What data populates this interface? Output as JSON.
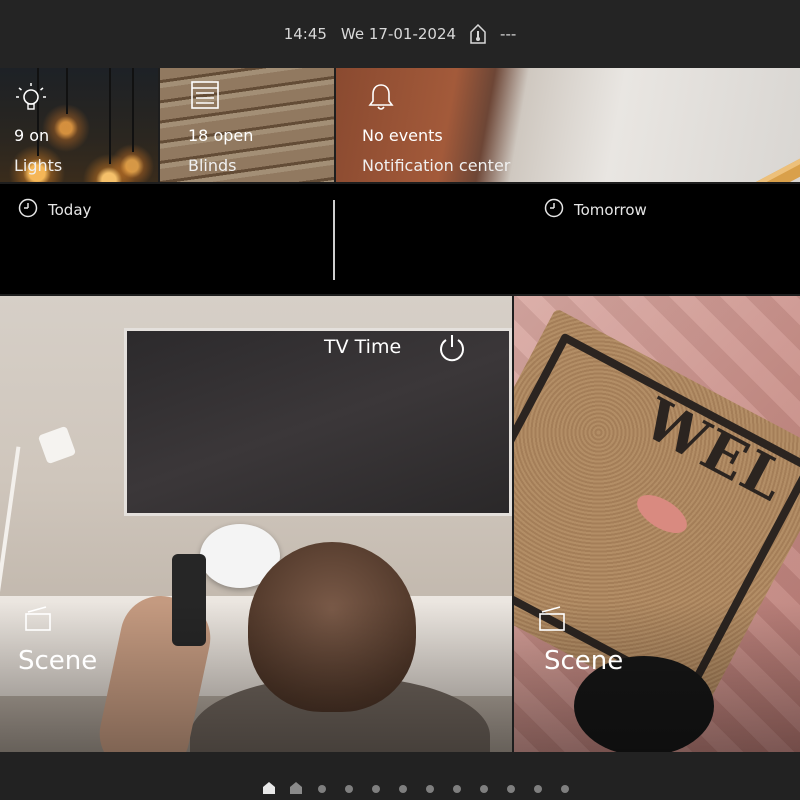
{
  "status": {
    "time": "14:45",
    "date": "We 17-01-2024",
    "extra": "---",
    "icon": "home-thermometer-icon"
  },
  "tiles": {
    "lights": {
      "value": "9 on",
      "label": "Lights",
      "icon": "lightbulb-icon"
    },
    "blinds": {
      "value": "18 open",
      "label": "Blinds",
      "icon": "blinds-icon"
    },
    "notifications": {
      "value": "No events",
      "label": "Notification center",
      "icon": "bell-icon"
    }
  },
  "calendar": {
    "today": {
      "label": "Today",
      "icon": "clock-icon"
    },
    "tomorrow": {
      "label": "Tomorrow",
      "icon": "clock-icon"
    }
  },
  "scenes": [
    {
      "type_label": "Scene",
      "title": "TV Time",
      "icon": "scene-icon",
      "power_icon": "power-icon"
    },
    {
      "type_label": "Scene",
      "image_text": "WEL",
      "icon": "scene-icon"
    }
  ],
  "pager": {
    "page_count": 12,
    "active_page": 1
  },
  "colors": {
    "background": "#1e1e1e",
    "calendar_bg": "#000000",
    "text": "#ffffff"
  }
}
